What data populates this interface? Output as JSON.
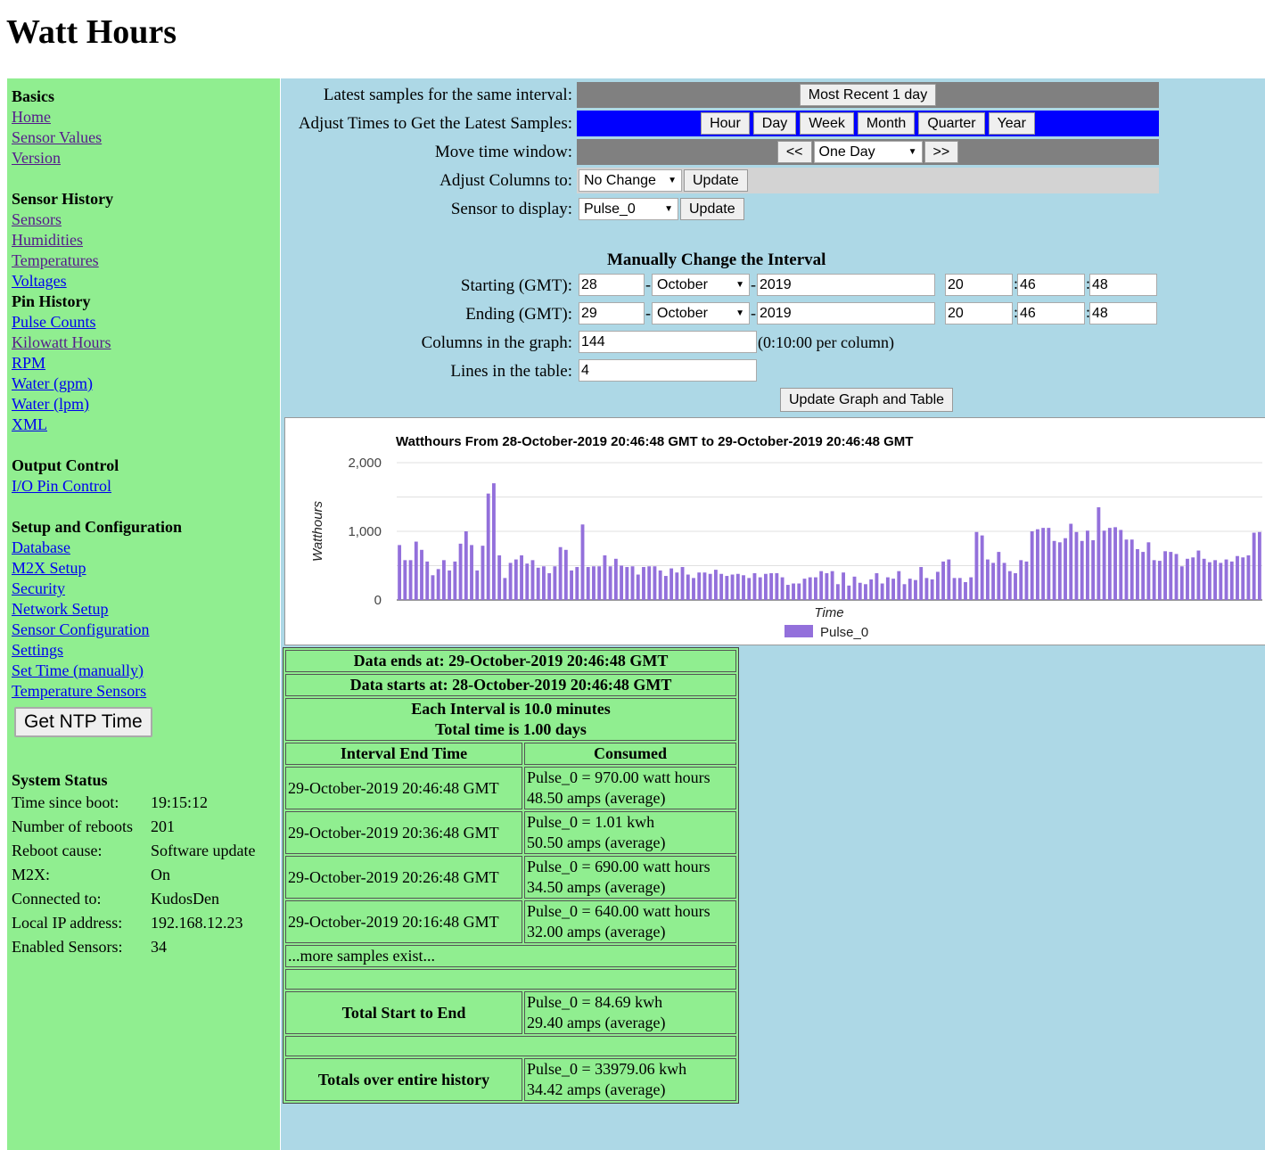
{
  "page_title": "Watt Hours",
  "sidebar": {
    "basics": {
      "title": "Basics",
      "links": [
        "Home",
        "Sensor Values",
        "Version"
      ]
    },
    "sensor_history": {
      "title": "Sensor History",
      "links": [
        "Sensors",
        "Humidities",
        "Temperatures",
        "Voltages"
      ]
    },
    "pin_history": {
      "title": "Pin History",
      "links": [
        "Pulse Counts",
        "Kilowatt Hours",
        "RPM",
        "Water (gpm)",
        "Water (lpm)",
        "XML"
      ]
    },
    "output_control": {
      "title": "Output Control",
      "links": [
        "I/O Pin Control"
      ]
    },
    "setup": {
      "title": "Setup and Configuration",
      "links": [
        "Database",
        "M2X Setup",
        "Security",
        "Network Setup",
        "Sensor Configuration",
        "Settings",
        "Set Time (manually)",
        "Temperature Sensors"
      ]
    },
    "ntp_button": "Get NTP Time",
    "status": {
      "title": "System Status",
      "rows": [
        {
          "k": "Time since boot:",
          "v": "19:15:12"
        },
        {
          "k": "Number of reboots",
          "v": "201"
        },
        {
          "k": "Reboot cause:",
          "v": "Software update"
        },
        {
          "k": "M2X:",
          "v": "On"
        },
        {
          "k": "Connected to:",
          "v": "KudosDen"
        },
        {
          "k": "Local IP address:",
          "v": "192.168.12.23"
        },
        {
          "k": "Enabled Sensors:",
          "v": "34"
        }
      ]
    }
  },
  "controls": {
    "latest_label": "Latest samples for the same interval:",
    "latest_button": "Most Recent 1 day",
    "adjust_label": "Adjust Times to Get the Latest Samples:",
    "adjust_buttons": [
      "Hour",
      "Day",
      "Week",
      "Month",
      "Quarter",
      "Year"
    ],
    "move_label": "Move time window:",
    "move_prev": "<<",
    "move_select": "One Day",
    "move_next": ">>",
    "columns_label": "Adjust Columns to:",
    "columns_select": "No Change",
    "columns_update": "Update",
    "sensor_label": "Sensor to display:",
    "sensor_select": "Pulse_0",
    "sensor_update": "Update"
  },
  "manual": {
    "title": "Manually Change the Interval",
    "start_label": "Starting (GMT):",
    "start": {
      "day": "28",
      "month": "October",
      "year": "2019",
      "hour": "20",
      "min": "46",
      "sec": "48"
    },
    "end_label": "Ending (GMT):",
    "end": {
      "day": "29",
      "month": "October",
      "year": "2019",
      "hour": "20",
      "min": "46",
      "sec": "48"
    },
    "columns_label": "Columns in the graph:",
    "columns_value": "144",
    "columns_note": "(0:10:00 per column)",
    "lines_label": "Lines in the table:",
    "lines_value": "4",
    "update_button": "Update Graph and Table",
    "dash": "-",
    "colon": ":"
  },
  "chart_data": {
    "type": "bar",
    "title": "Watthours From 28-October-2019 20:46:48 GMT to 29-October-2019 20:46:48 GMT",
    "xlabel": "Time",
    "ylabel": "Watthours",
    "yticks": [
      "0",
      "1,000",
      "2,000"
    ],
    "ylim": [
      0,
      2000
    ],
    "legend": "bottom",
    "color": "#9370db",
    "series": [
      {
        "name": "Pulse_0",
        "values": [
          800,
          580,
          580,
          850,
          730,
          560,
          360,
          450,
          580,
          430,
          560,
          820,
          1000,
          800,
          430,
          790,
          1550,
          1700,
          650,
          320,
          540,
          590,
          650,
          530,
          580,
          470,
          490,
          390,
          490,
          770,
          730,
          430,
          480,
          1100,
          480,
          490,
          490,
          650,
          490,
          600,
          500,
          480,
          490,
          370,
          480,
          490,
          490,
          430,
          350,
          460,
          400,
          480,
          370,
          320,
          400,
          400,
          380,
          440,
          380,
          350,
          370,
          380,
          360,
          320,
          390,
          330,
          380,
          390,
          390,
          330,
          220,
          240,
          240,
          310,
          330,
          330,
          420,
          390,
          420,
          230,
          400,
          210,
          340,
          250,
          230,
          300,
          390,
          240,
          330,
          310,
          420,
          230,
          310,
          290,
          480,
          320,
          300,
          410,
          560,
          590,
          320,
          320,
          260,
          330,
          990,
          940,
          590,
          540,
          700,
          540,
          420,
          390,
          580,
          560,
          1000,
          1030,
          1050,
          1050,
          860,
          840,
          900,
          1110,
          990,
          860,
          1010,
          870,
          1350,
          1010,
          1050,
          1060,
          1020,
          880,
          880,
          740,
          700,
          840,
          580,
          570,
          710,
          700,
          670,
          490,
          600,
          620,
          720,
          600,
          550,
          580,
          540,
          590,
          560,
          640,
          620,
          650,
          980,
          990
        ]
      }
    ]
  },
  "table": {
    "ends": "Data ends at: 29-October-2019 20:46:48 GMT",
    "starts": "Data starts at: 28-October-2019 20:46:48 GMT",
    "interval": "Each Interval is 10.0 minutes",
    "total_time": "Total time is 1.00 days",
    "col_time": "Interval End Time",
    "col_consumed": "Consumed",
    "rows": [
      {
        "time": "29-October-2019 20:46:48 GMT",
        "line1": "Pulse_0 = 970.00 watt hours",
        "line2": "48.50 amps (average)"
      },
      {
        "time": "29-October-2019 20:36:48 GMT",
        "line1": "Pulse_0 = 1.01 kwh",
        "line2": "50.50 amps (average)"
      },
      {
        "time": "29-October-2019 20:26:48 GMT",
        "line1": "Pulse_0 = 690.00 watt hours",
        "line2": "34.50 amps (average)"
      },
      {
        "time": "29-October-2019 20:16:48 GMT",
        "line1": "Pulse_0 = 640.00 watt hours",
        "line2": "32.00 amps (average)"
      }
    ],
    "more": "...more samples exist...",
    "total_label": "Total Start to End",
    "total_line1": "Pulse_0 = 84.69 kwh",
    "total_line2": "29.40 amps (average)",
    "history_label": "Totals over entire history",
    "history_line1": "Pulse_0 = 33979.06 kwh",
    "history_line2": "34.42 amps (average)"
  }
}
